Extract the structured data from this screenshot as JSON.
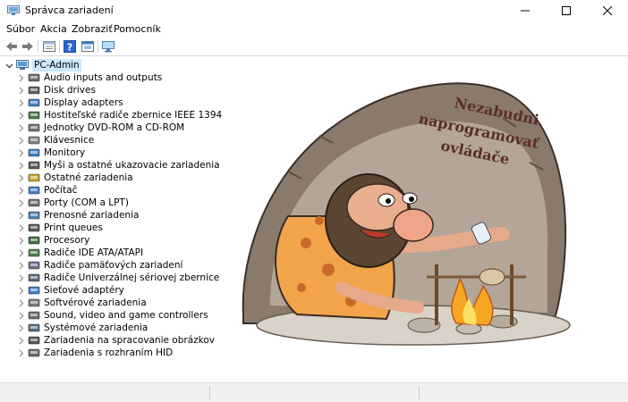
{
  "window": {
    "title": "Správca zariadení"
  },
  "menu": [
    "Súbor",
    "Akcia",
    "Zobraziť",
    "Pomocník"
  ],
  "toolbar_icons": [
    "back-icon",
    "forward-icon",
    "properties-icon",
    "help-icon",
    "update-driver-icon",
    "scan-hardware-icon"
  ],
  "tree": {
    "root": "PC-Admin",
    "items": [
      {
        "label": "Audio inputs and outputs",
        "icon": "speaker-icon"
      },
      {
        "label": "Disk drives",
        "icon": "disk-icon"
      },
      {
        "label": "Display adapters",
        "icon": "display-adapter-icon"
      },
      {
        "label": "Hostiteľské radiče zbernice IEEE 1394",
        "icon": "ieee1394-icon"
      },
      {
        "label": "Jednotky DVD-ROM a CD-ROM",
        "icon": "dvd-icon"
      },
      {
        "label": "Klávesnice",
        "icon": "keyboard-icon"
      },
      {
        "label": "Monitory",
        "icon": "monitor-icon"
      },
      {
        "label": "Myši a ostatné ukazovacie zariadenia",
        "icon": "mouse-icon"
      },
      {
        "label": "Ostatné zariadenia",
        "icon": "unknown-device-icon"
      },
      {
        "label": "Počítač",
        "icon": "computer-icon"
      },
      {
        "label": "Porty (COM a LPT)",
        "icon": "port-icon"
      },
      {
        "label": "Prenosné zariadenia",
        "icon": "portable-device-icon"
      },
      {
        "label": "Print queues",
        "icon": "printer-icon"
      },
      {
        "label": "Procesory",
        "icon": "processor-icon"
      },
      {
        "label": "Radiče IDE ATA/ATAPI",
        "icon": "ide-icon"
      },
      {
        "label": "Radiče pamäťových zariadení",
        "icon": "storage-controller-icon"
      },
      {
        "label": "Radiče Univerzálnej sériovej zbernice",
        "icon": "usb-icon"
      },
      {
        "label": "Sieťové adaptéry",
        "icon": "network-adapter-icon"
      },
      {
        "label": "Softvérové zariadenia",
        "icon": "software-device-icon"
      },
      {
        "label": "Sound, video and game controllers",
        "icon": "sound-icon"
      },
      {
        "label": "Systémové zariadenia",
        "icon": "system-device-icon"
      },
      {
        "label": "Zariadenia na spracovanie obrázkov",
        "icon": "camera-icon"
      },
      {
        "label": "Zariadenia s rozhraním HID",
        "icon": "hid-icon"
      }
    ]
  },
  "illustration": {
    "caption_lines": [
      "Nezabudni",
      "naprogramovať",
      "ovládače"
    ],
    "caption_color": "#5a2d2a"
  },
  "colors": {
    "selection": "#cce8ff",
    "accent": "#0078d7"
  }
}
